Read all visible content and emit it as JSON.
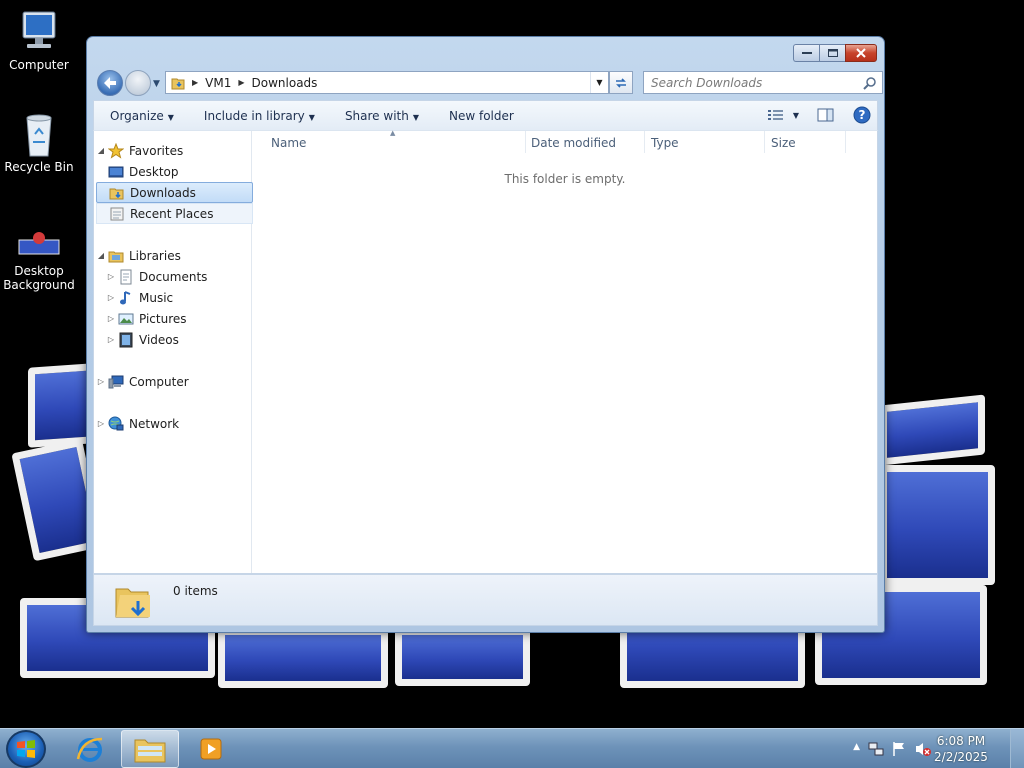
{
  "desktop": {
    "icons": [
      {
        "name": "computer",
        "label": "Computer"
      },
      {
        "name": "recycle-bin",
        "label": "Recycle Bin"
      },
      {
        "name": "desktop-background",
        "label": "Desktop Background"
      }
    ]
  },
  "window": {
    "breadcrumb": [
      "VM1",
      "Downloads"
    ],
    "search_placeholder": "Search Downloads",
    "toolbar": {
      "organize": "Organize",
      "include_in_library": "Include in library",
      "share_with": "Share with",
      "new_folder": "New folder"
    },
    "nav": {
      "favorites": "Favorites",
      "desktop": "Desktop",
      "downloads": "Downloads",
      "recent_places": "Recent Places",
      "libraries": "Libraries",
      "documents": "Documents",
      "music": "Music",
      "pictures": "Pictures",
      "videos": "Videos",
      "computer": "Computer",
      "network": "Network"
    },
    "columns": {
      "name": "Name",
      "date_modified": "Date modified",
      "type": "Type",
      "size": "Size"
    },
    "empty_message": "This folder is empty.",
    "item_count": "0 items"
  },
  "taskbar": {
    "time": "6:08 PM",
    "date": "2/2/2025"
  }
}
